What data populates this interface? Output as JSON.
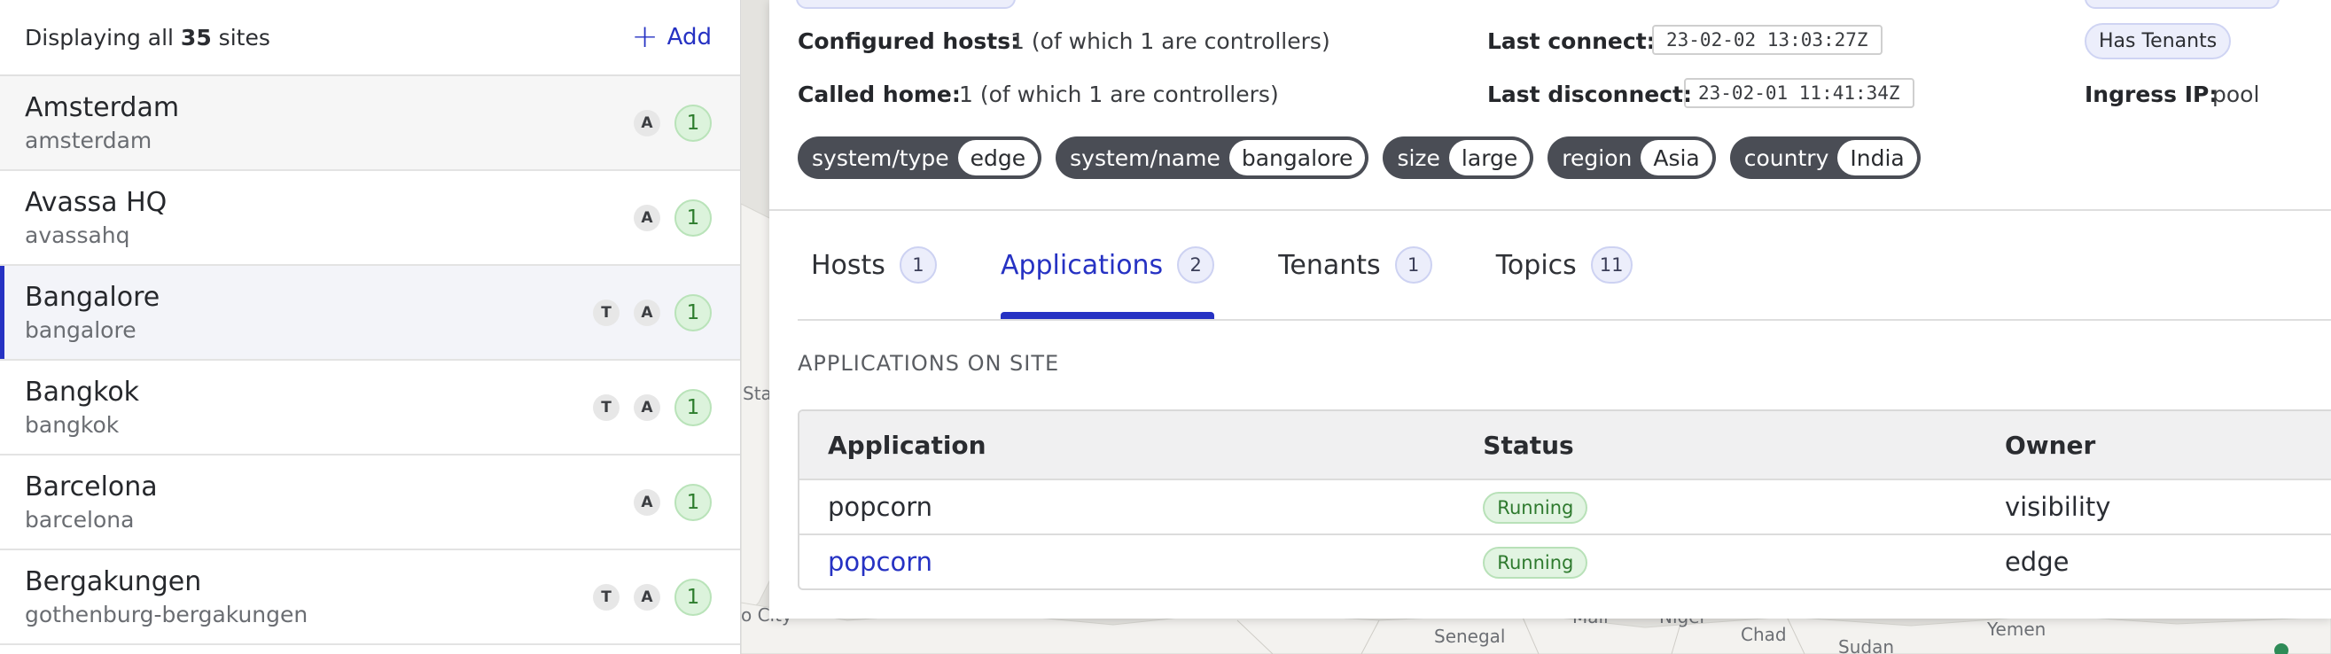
{
  "sidebar": {
    "count_prefix": "Displaying all ",
    "count": "35",
    "count_suffix": " sites",
    "add_label": "Add",
    "add_icon": "plus-icon",
    "sites": [
      {
        "name": "Amsterdam",
        "slug": "amsterdam",
        "badges": [
          "A"
        ],
        "count": "1",
        "state": "hover"
      },
      {
        "name": "Avassa HQ",
        "slug": "avassahq",
        "badges": [
          "A"
        ],
        "count": "1",
        "state": ""
      },
      {
        "name": "Bangalore",
        "slug": "bangalore",
        "badges": [
          "T",
          "A"
        ],
        "count": "1",
        "state": "selected"
      },
      {
        "name": "Bangkok",
        "slug": "bangkok",
        "badges": [
          "T",
          "A"
        ],
        "count": "1",
        "state": ""
      },
      {
        "name": "Barcelona",
        "slug": "barcelona",
        "badges": [
          "A"
        ],
        "count": "1",
        "state": ""
      },
      {
        "name": "Bergakungen",
        "slug": "gothenburg-bergakungen",
        "badges": [
          "T",
          "A"
        ],
        "count": "1",
        "state": ""
      }
    ]
  },
  "detail": {
    "configured_hosts_label": "Configured hosts:",
    "configured_hosts_value": "1 (of which 1 are controllers)",
    "called_home_label": "Called home:",
    "called_home_value": "1 (of which 1 are controllers)",
    "last_connect_label": "Last connect:",
    "last_connect_value": "23-02-02 13:03:27Z",
    "last_disconnect_label": "Last disconnect:",
    "last_disconnect_value": "23-02-01 11:41:34Z",
    "has_tenants": "Has Tenants",
    "ingress_label": "Ingress IP:",
    "ingress_value": "pool",
    "labels": [
      {
        "key": "system/type",
        "value": "edge"
      },
      {
        "key": "system/name",
        "value": "bangalore"
      },
      {
        "key": "size",
        "value": "large"
      },
      {
        "key": "region",
        "value": "Asia"
      },
      {
        "key": "country",
        "value": "India"
      }
    ]
  },
  "tabs": [
    {
      "label": "Hosts",
      "count": "1",
      "active": false
    },
    {
      "label": "Applications",
      "count": "2",
      "active": true
    },
    {
      "label": "Tenants",
      "count": "1",
      "active": false
    },
    {
      "label": "Topics",
      "count": "11",
      "active": false
    }
  ],
  "applications": {
    "section_title": "APPLICATIONS ON SITE",
    "columns": {
      "application": "Application",
      "status": "Status",
      "owner": "Owner"
    },
    "rows": [
      {
        "application": "popcorn",
        "status": "Running",
        "owner": "visibility",
        "link": false
      },
      {
        "application": "popcorn",
        "status": "Running",
        "owner": "edge",
        "link": true
      }
    ]
  },
  "map": {
    "labels": [
      "Sta",
      "o City",
      "Mali",
      "Niger",
      "Chad",
      "Sudan",
      "Senegal",
      "Yemen"
    ],
    "land_color": "#f3f2ef",
    "water_color": "#e1e0dc",
    "marker_color": "#2e8b57"
  },
  "colors": {
    "accent": "#2632c3",
    "running_green": "#2e7a2e",
    "label_dark": "#4a4d55"
  }
}
